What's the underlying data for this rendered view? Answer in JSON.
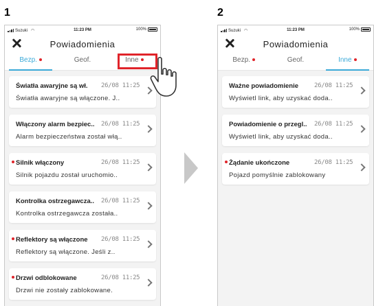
{
  "steps": [
    "1",
    "2"
  ],
  "status_bar": {
    "carrier": "Suzuki",
    "time": "11:23 PM",
    "battery": "100%"
  },
  "header": {
    "title": "Powiadomienia"
  },
  "tabs": [
    {
      "label": "Bezp.",
      "has_dot": true
    },
    {
      "label": "Geof.",
      "has_dot": false
    },
    {
      "label": "Inne",
      "has_dot": true
    }
  ],
  "screen1": {
    "active_tab": 0,
    "notifications": [
      {
        "title": "Światła awaryjne są wł.",
        "date": "26/08 11:25",
        "body": "Światła awaryjne są włączone. J..",
        "unread": false
      },
      {
        "title": "Włączony alarm bezpiec..",
        "date": "26/08 11:25",
        "body": "Alarm bezpieczeństwa został włą..",
        "unread": false
      },
      {
        "title": "Silnik włączony",
        "date": "26/08 11:25",
        "body": "Silnik pojazdu został uruchomio..",
        "unread": true
      },
      {
        "title": "Kontrolka ostrzegawcza..",
        "date": "26/08 11:25",
        "body": "Kontrolka ostrzegawcza została..",
        "unread": false
      },
      {
        "title": "Reflektory są włączone",
        "date": "26/08 11:25",
        "body": "Reflektory są włączone. Jeśli z..",
        "unread": true
      },
      {
        "title": "Drzwi odblokowane",
        "date": "26/08 11:25",
        "body": "Drzwi nie zostały zablokowane.",
        "unread": true
      }
    ]
  },
  "screen2": {
    "active_tab": 2,
    "notifications": [
      {
        "title": "Ważne powiadomienie",
        "date": "26/08 11:25",
        "body": "Wyświetl link, aby uzyskać doda..",
        "unread": false
      },
      {
        "title": "Powiadomienie o przegl..",
        "date": "26/08 11:25",
        "body": "Wyświetl link, aby uzyskać doda..",
        "unread": false
      },
      {
        "title": "Żądanie ukończone",
        "date": "26/08 11:25",
        "body": "Pojazd pomyślnie zablokowany",
        "unread": true
      }
    ]
  },
  "colors": {
    "accent": "#3aa9d8",
    "alert": "#e0242a",
    "background": "#f3f3f3"
  }
}
